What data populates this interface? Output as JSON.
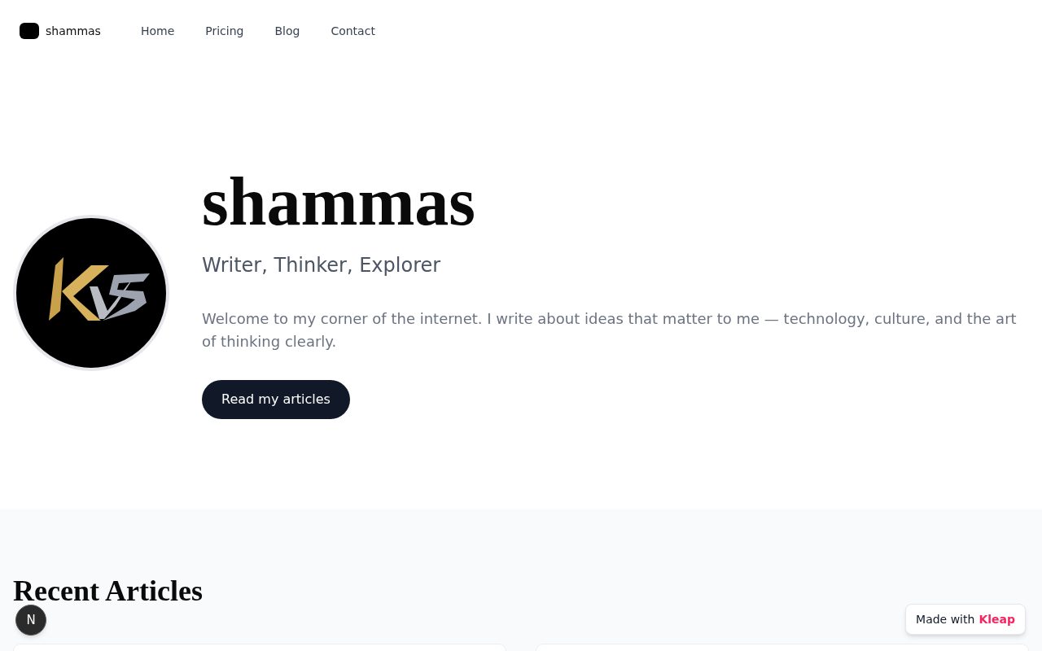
{
  "nav": {
    "brand": "shammas",
    "links": [
      "Home",
      "Pricing",
      "Blog",
      "Contact"
    ]
  },
  "hero": {
    "title": "shammas",
    "subtitle": "Writer, Thinker, Explorer",
    "intro": "Welcome to my corner of the internet. I write about ideas that matter to me — technology, culture, and the art of thinking clearly.",
    "button": "Read my articles"
  },
  "recent": {
    "heading": "Recent Articles"
  },
  "dev_badge": {
    "label": "N"
  },
  "made_with": {
    "label": "Made with",
    "brand": "Kleap"
  }
}
